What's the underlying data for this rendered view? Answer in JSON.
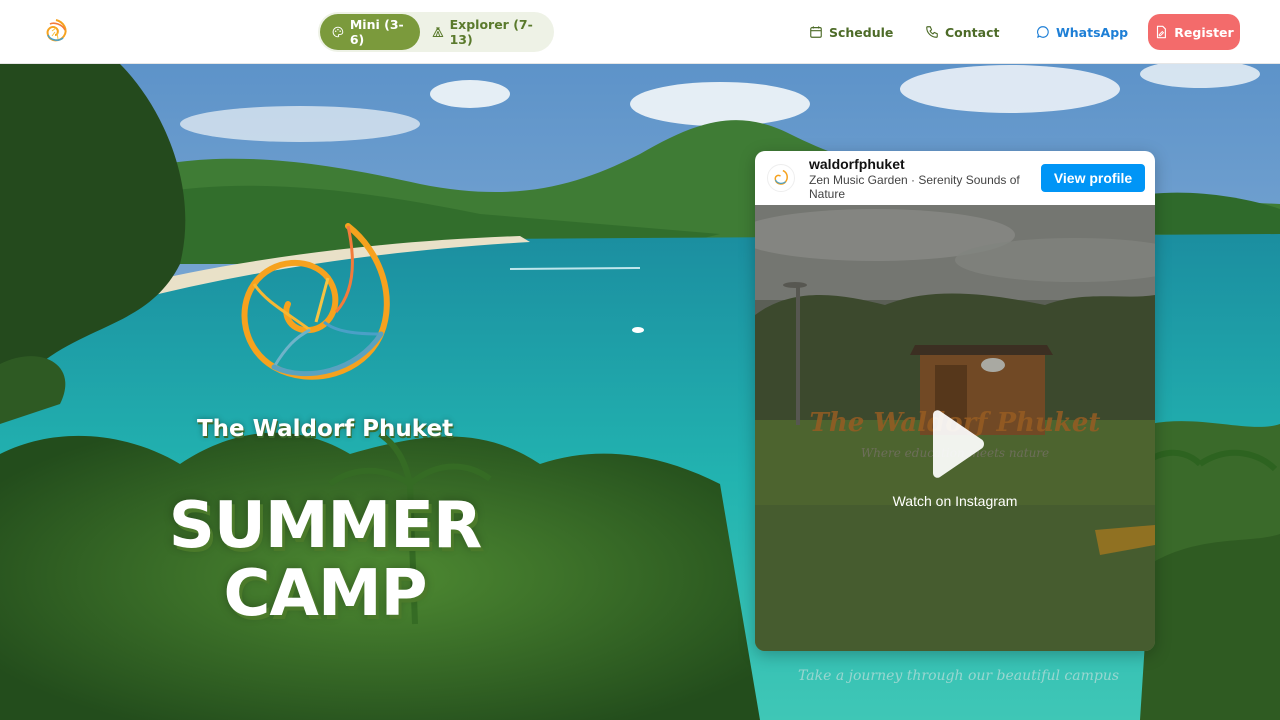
{
  "header": {
    "logo_icon": "nautilus-logo-icon",
    "age_groups": [
      {
        "label": "Mini (3-6)",
        "icon": "palette-icon",
        "active": true
      },
      {
        "label": "Explorer (7-13)",
        "icon": "tent-icon",
        "active": false
      }
    ],
    "nav": {
      "schedule": {
        "label": "Schedule",
        "icon": "calendar-icon"
      },
      "contact": {
        "label": "Contact",
        "icon": "phone-icon"
      },
      "whatsapp": {
        "label": "WhatsApp",
        "icon": "chat-bubble-icon"
      }
    },
    "register_label": "Register"
  },
  "hero": {
    "school_name": "The Waldorf Phuket",
    "title": "SUMMER CAMP",
    "caption": "Take a journey through our beautiful campus"
  },
  "instagram": {
    "username": "waldorfphuket",
    "subtitle": "Zen Music Garden · Serenity Sounds of Nature",
    "view_profile_label": "View profile",
    "watch_label": "Watch on Instagram"
  },
  "colors": {
    "accent_green": "#7b9a3c",
    "nav_green": "#4d6b28",
    "whatsapp_blue": "#1e7fd6",
    "register_red": "#f36b6b",
    "instagram_blue": "#0095f6"
  }
}
